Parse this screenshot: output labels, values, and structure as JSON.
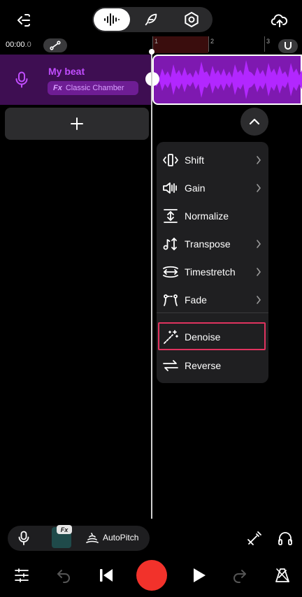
{
  "topbar": {
    "back_icon": "exit-arrow-icon",
    "modes": [
      {
        "name": "waveform-mode",
        "icon": "waveform-icon",
        "active": true
      },
      {
        "name": "feather-mode",
        "icon": "feather-icon",
        "active": false
      },
      {
        "name": "settings-mode",
        "icon": "hexagon-gear-icon",
        "active": false
      }
    ],
    "upload_icon": "cloud-upload-icon"
  },
  "timeline": {
    "time_main": "00:00",
    "time_ms": ".0",
    "bar_numbers": [
      "1",
      "2",
      "3"
    ]
  },
  "track": {
    "title": "My beat",
    "fx_prefix": "Fx",
    "fx_name": "Classic Chamber"
  },
  "menu": {
    "items": [
      {
        "label": "Shift",
        "icon": "shift-icon",
        "has_submenu": true
      },
      {
        "label": "Gain",
        "icon": "speaker-gain-icon",
        "has_submenu": true
      },
      {
        "label": "Normalize",
        "icon": "normalize-icon",
        "has_submenu": false
      },
      {
        "label": "Transpose",
        "icon": "transpose-icon",
        "has_submenu": true
      },
      {
        "label": "Timestretch",
        "icon": "timestretch-icon",
        "has_submenu": true
      },
      {
        "label": "Fade",
        "icon": "fade-icon",
        "has_submenu": true
      },
      {
        "label": "Denoise",
        "icon": "magic-wand-icon",
        "has_submenu": false,
        "highlighted": true
      },
      {
        "label": "Reverse",
        "icon": "reverse-arrows-icon",
        "has_submenu": false
      }
    ]
  },
  "bottom": {
    "autopitch_label": "AutoPitch",
    "fx_badge": "Fx"
  },
  "colors": {
    "accent_purple": "#c14dff",
    "record_red": "#f2322b",
    "highlight_pink": "#e0335f"
  }
}
